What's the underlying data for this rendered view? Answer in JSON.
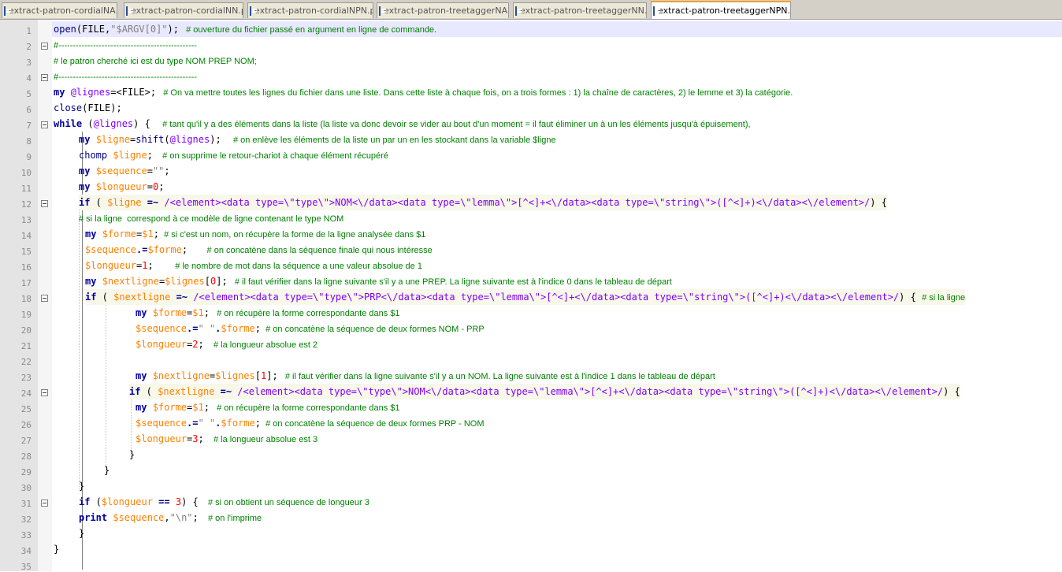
{
  "tabs": [
    {
      "label": "extract-patron-cordialNA.pl",
      "active": false
    },
    {
      "label": "extract-patron-cordialNN.pl",
      "active": false
    },
    {
      "label": "extract-patron-cordialNPN.pl",
      "active": false
    },
    {
      "label": "extract-patron-treetaggerNA.pl",
      "active": false
    },
    {
      "label": "extract-patron-treetaggerNN.pl",
      "active": false
    },
    {
      "label": "extract-patron-treetaggerNPN.pl",
      "active": true
    }
  ],
  "line_numbers": [
    "1",
    "2",
    "3",
    "4",
    "5",
    "6",
    "7",
    "8",
    "9",
    "10",
    "11",
    "12",
    "13",
    "14",
    "15",
    "16",
    "17",
    "18",
    "19",
    "20",
    "21",
    "22",
    "23",
    "24",
    "25",
    "26",
    "27",
    "28",
    "29",
    "30",
    "31",
    "32",
    "33",
    "34",
    "35"
  ],
  "code": {
    "l1": [
      "open",
      "(FILE,",
      "\"$ARGV[0]\"",
      ");",
      "   # ouverture du fichier passé en argument en ligne de commande."
    ],
    "l2": [
      "#------------------------------------------------"
    ],
    "l3": [
      "# le patron cherché ici est du type NOM PREP NOM;"
    ],
    "l4": [
      "#------------------------------------------------"
    ],
    "l5": [
      "my ",
      "@lignes",
      "=<FILE>;",
      "   # On va mettre toutes les lignes du fichier dans une liste. Dans cette liste à chaque fois, on a trois formes : 1) la chaîne de caractères, 2) le lemme et 3) la catégorie."
    ],
    "l6": [
      "close",
      "(FILE);"
    ],
    "l7": [
      "while",
      " (",
      "@lignes",
      ") {",
      "     # tant qu'il y a des éléments dans la liste (la liste va donc devoir se vider au bout d'un moment = il faut éliminer un à un les éléments jusqu'à épuisement),"
    ],
    "l8": [
      "my ",
      "$ligne",
      "=",
      "shift",
      "(",
      "@lignes",
      ");",
      "     # on enlève les éléments de la liste un par un en les stockant dans la variable $ligne"
    ],
    "l9": [
      "chomp ",
      "$ligne",
      ";",
      "    # on supprime le retour-chariot à chaque élément récupéré"
    ],
    "l10": [
      "my ",
      "$sequence",
      "=",
      "\"\"",
      ";"
    ],
    "l11": [
      "my ",
      "$longueur",
      "=",
      "0",
      ";"
    ],
    "l12": [
      "if",
      " ( ",
      "$ligne",
      " =~ ",
      "/<element><data type=\\\"type\\\">NOM<\\/data><data type=\\\"lemma\\\">[^<]+<\\/data><data type=\\\"string\\\">([^<]+)<\\/data><\\/element>/",
      ") {"
    ],
    "l13": [
      "# si la ligne  correspond à ce modèle de ligne contenant le type NOM"
    ],
    "l14": [
      "my ",
      "$forme",
      "=",
      "$1",
      ";",
      "  # si c'est un nom, on récupère la forme de la ligne analysée dans $1"
    ],
    "l15": [
      "$sequence",
      ".=",
      "$forme",
      ";",
      "        # on concatène dans la séquence finale qui nous intéresse"
    ],
    "l16": [
      "$longueur",
      "=",
      "1",
      ";",
      "         # le nombre de mot dans la séquence a une valeur absolue de 1"
    ],
    "l17": [
      "my ",
      "$nextligne",
      "=",
      "$lignes",
      "[",
      "0",
      "];",
      "   # il faut vérifier dans la ligne suivante s'il y a une PREP. La ligne suivante est à l'indice 0 dans le tableau de départ"
    ],
    "l18": [
      "if",
      " ( ",
      "$nextligne",
      " =~ ",
      "/<element><data type=\\\"type\\\">PRP<\\/data><data type=\\\"lemma\\\">[^<]+<\\/data><data type=\\\"string\\\">([^<]+)<\\/data><\\/element>/",
      ") { ",
      "# si la ligne"
    ],
    "l19": [
      "my ",
      "$forme",
      "=",
      "$1",
      ";",
      "   # on récupère la forme correspondante dans $1"
    ],
    "l20": [
      "$sequence",
      ".=",
      "\" \"",
      ".",
      "$forme",
      ";",
      "  # on concatène la séquence de deux formes NOM - PRP"
    ],
    "l21": [
      "$longueur",
      "=",
      "2",
      ";",
      "    # la longueur absolue est 2"
    ],
    "l23": [
      "my ",
      "$nextligne",
      "=",
      "$lignes",
      "[",
      "1",
      "];",
      "   # il faut vérifier dans la ligne suivante s'il y a un NOM. La ligne suivante est à l'indice 1 dans le tableau de départ"
    ],
    "l24": [
      "if",
      " ( ",
      "$nextligne",
      " =~ ",
      "/<element><data type=\\\"type\\\">NOM<\\/data><data type=\\\"lemma\\\">[^<]+<\\/data><data type=\\\"string\\\">([^<]+)<\\/data><\\/element>/",
      ") {"
    ],
    "l25": [
      "my ",
      "$forme",
      "=",
      "$1",
      ";",
      "   # on récupère la forme correspondante dans $1"
    ],
    "l26": [
      "$sequence",
      ".=",
      "\" \"",
      ".",
      "$forme",
      ";",
      "  # on concatène la séquence de deux formes PRP - NOM"
    ],
    "l27": [
      "$longueur",
      "=",
      "3",
      ";",
      "    # la longueur absolue est 3"
    ],
    "l28": [
      "}"
    ],
    "l29": [
      "}"
    ],
    "l30": [
      "}"
    ],
    "l31": [
      "if",
      " (",
      "$longueur",
      " == ",
      "3",
      ") {",
      "    # si on obtient un séquence de longueur 3"
    ],
    "l32": [
      "print ",
      "$sequence",
      ",",
      "\"\\n\"",
      ";",
      "    # on l'imprime"
    ],
    "l33": [
      "}"
    ],
    "l34": [
      "}"
    ]
  }
}
